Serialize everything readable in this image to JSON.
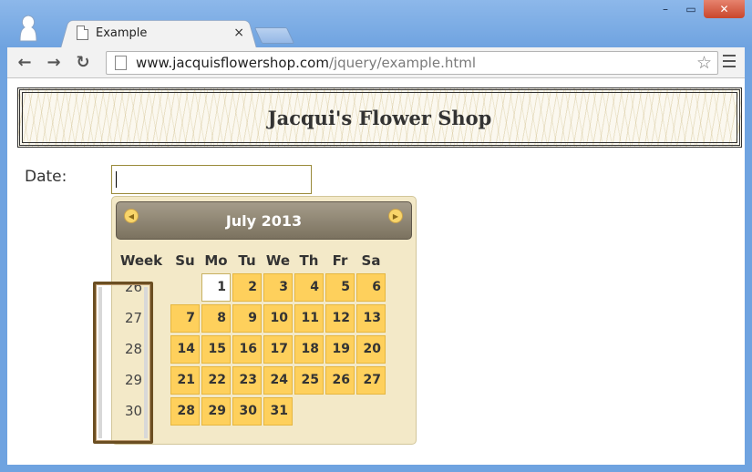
{
  "browser": {
    "tab_title": "Example",
    "tab_close": "×",
    "url_host": "www.jacquisflowershop.com",
    "url_path": "/jquery/example.html",
    "window_buttons": {
      "minimize": "–",
      "maximize": "▭",
      "close": "✕"
    }
  },
  "page": {
    "banner_title": "Jacqui's Flower Shop",
    "date_label": "Date:",
    "date_value": ""
  },
  "datepicker": {
    "month_title": "July 2013",
    "week_header": "Week",
    "day_headers": [
      "Su",
      "Mo",
      "Tu",
      "We",
      "Th",
      "Fr",
      "Sa"
    ],
    "today": "1",
    "weeks": [
      {
        "week": "26",
        "days": [
          "",
          "1",
          "2",
          "3",
          "4",
          "5",
          "6"
        ]
      },
      {
        "week": "27",
        "days": [
          "7",
          "8",
          "9",
          "10",
          "11",
          "12",
          "13"
        ]
      },
      {
        "week": "28",
        "days": [
          "14",
          "15",
          "16",
          "17",
          "18",
          "19",
          "20"
        ]
      },
      {
        "week": "29",
        "days": [
          "21",
          "22",
          "23",
          "24",
          "25",
          "26",
          "27"
        ]
      },
      {
        "week": "30",
        "days": [
          "28",
          "29",
          "30",
          "31",
          "",
          "",
          ""
        ]
      }
    ]
  }
}
